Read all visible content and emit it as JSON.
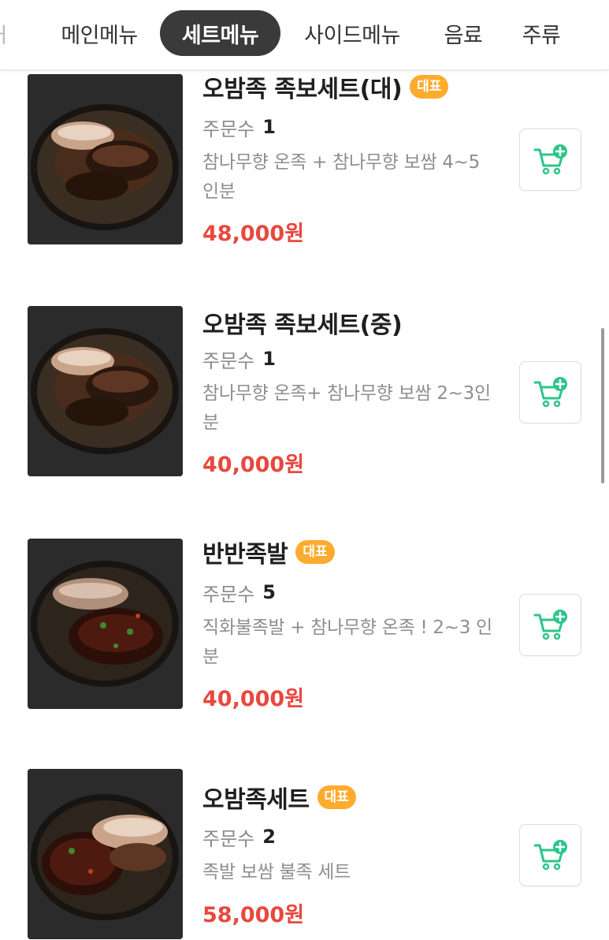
{
  "tabs": [
    {
      "label": "메인메뉴",
      "active": false
    },
    {
      "label": "세트메뉴",
      "active": true
    },
    {
      "label": "사이드메뉴",
      "active": false
    },
    {
      "label": "음료",
      "active": false
    },
    {
      "label": "주류",
      "active": false
    }
  ],
  "tabs_partial_label": "ㅓ",
  "order_label": "주문수",
  "badge_label": "대표",
  "items": [
    {
      "name": "오밤족 족보세트(대)",
      "badge": true,
      "orders": "1",
      "desc": "참나무향 온족 + 참나무향 보쌈 4~5인분",
      "price": "48,000원"
    },
    {
      "name": "오밤족 족보세트(중)",
      "badge": false,
      "orders": "1",
      "desc": "참나무향 온족+ 참나무향 보쌈 2~3인분",
      "price": "40,000원"
    },
    {
      "name": "반반족발",
      "badge": true,
      "orders": "5",
      "desc": "직화불족발 + 참나무향 온족 ! 2~3 인분",
      "price": "40,000원"
    },
    {
      "name": "오밤족세트",
      "badge": true,
      "orders": "2",
      "desc": "족발 보쌈 불족 세트",
      "price": "58,000원"
    }
  ],
  "colors": {
    "active_tab_bg": "#3a3a3a",
    "badge": "#ffab2e",
    "price": "#e8483e",
    "cart_icon": "#2ec58a"
  },
  "icons": {
    "cart": "cart-add-icon"
  }
}
